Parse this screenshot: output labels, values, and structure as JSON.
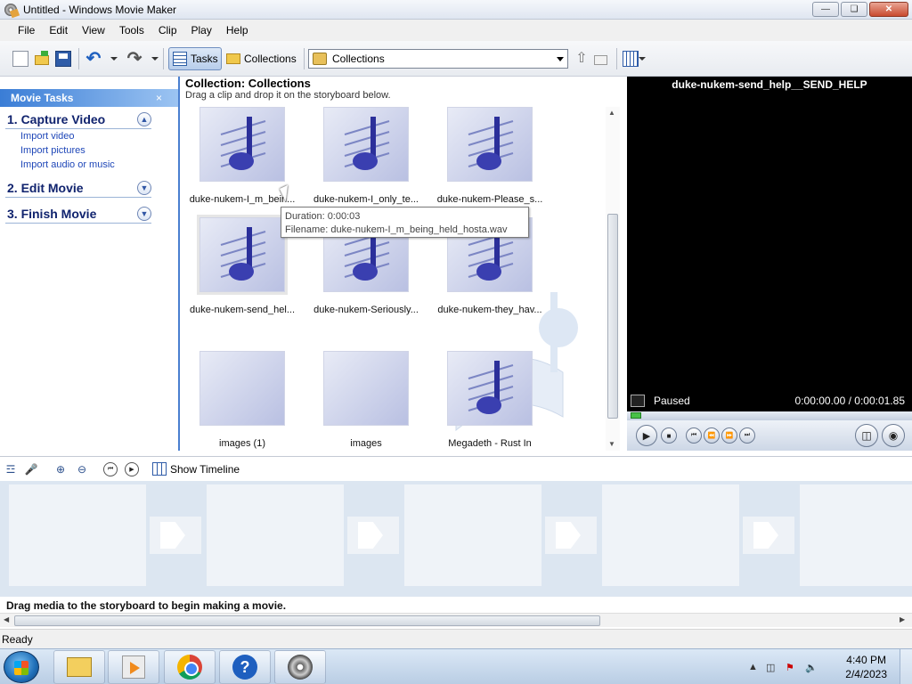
{
  "window": {
    "title": "Untitled - Windows Movie Maker"
  },
  "menu": [
    "File",
    "Edit",
    "View",
    "Tools",
    "Clip",
    "Play",
    "Help"
  ],
  "toolbar": {
    "tasks_label": "Tasks",
    "collections_label": "Collections",
    "collection_select": "Collections"
  },
  "tasks_pane": {
    "title": "Movie Tasks",
    "close": "×",
    "sections": [
      {
        "title": "1. Capture Video",
        "links": [
          "Import video",
          "Import pictures",
          "Import audio or music"
        ]
      },
      {
        "title": "2. Edit Movie"
      },
      {
        "title": "3. Finish Movie"
      }
    ]
  },
  "collection": {
    "title": "Collection: Collections",
    "subtitle": "Drag a clip and drop it on the storyboard below.",
    "clips": [
      {
        "label": "duke-nukem-I_m_bein...",
        "kind": "audio"
      },
      {
        "label": "duke-nukem-I_only_te...",
        "kind": "audio"
      },
      {
        "label": "duke-nukem-Please_s...",
        "kind": "audio"
      },
      {
        "label": "duke-nukem-send_hel...",
        "kind": "audio"
      },
      {
        "label": "duke-nukem-Seriously...",
        "kind": "audio"
      },
      {
        "label": "duke-nukem-they_hav...",
        "kind": "audio"
      },
      {
        "label": "images (1)",
        "kind": "image"
      },
      {
        "label": "images",
        "kind": "image"
      },
      {
        "label": "Megadeth - Rust In",
        "kind": "audio"
      }
    ],
    "tooltip": {
      "duration": "Duration:  0:00:03",
      "filename": "Filename: duke-nukem-I_m_being_held_hosta.wav"
    }
  },
  "preview": {
    "title": "duke-nukem-send_help__SEND_HELP",
    "status": "Paused",
    "time": "0:00:00.00 / 0:00:01.85"
  },
  "storyboard": {
    "show_timeline": "Show Timeline",
    "message": "Drag media to the storyboard to begin making a movie."
  },
  "status_bar": {
    "text": "Ready"
  },
  "taskbar": {
    "time": "4:40 PM",
    "date": "2/4/2023"
  }
}
